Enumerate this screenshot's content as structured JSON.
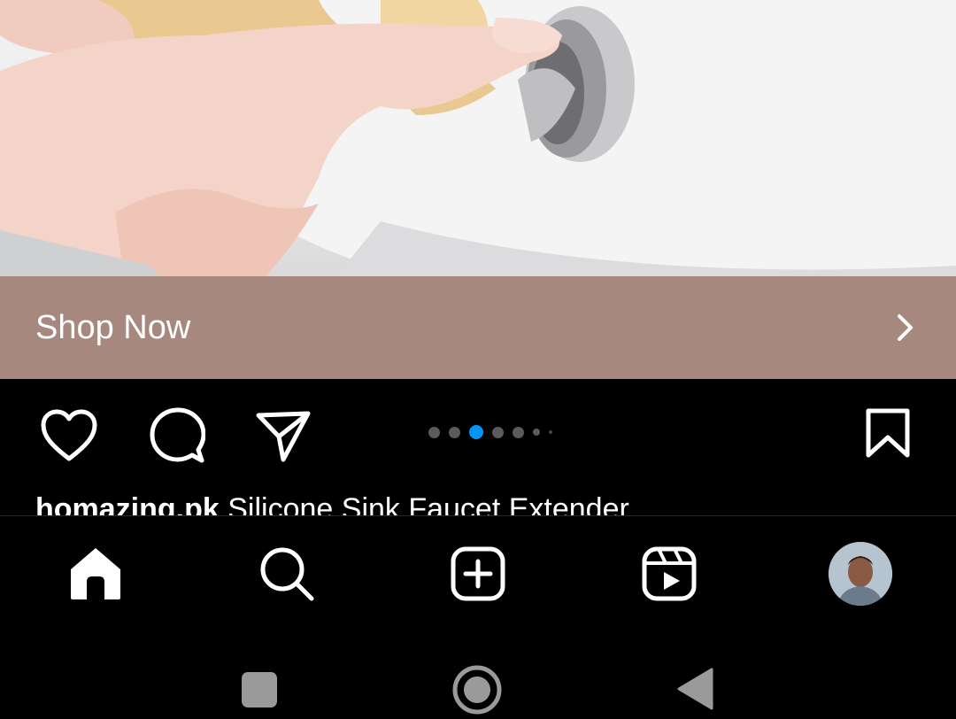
{
  "post_image": {
    "description_icon": "product-photo"
  },
  "cta": {
    "label": "Shop Now",
    "chevron_icon": "chevron-right-icon",
    "background": "#a6887f"
  },
  "actions": {
    "like_icon": "heart-icon",
    "comment_icon": "comment-icon",
    "share_icon": "send-icon",
    "save_icon": "bookmark-icon"
  },
  "carousel": {
    "active_index": 3,
    "total": 7,
    "active_color": "#0095f6"
  },
  "caption": {
    "username": "homazing.pk",
    "text": "Silicone Sink Faucet Extender"
  },
  "tabbar": {
    "items": [
      "home-icon",
      "search-icon",
      "create-post-icon",
      "reels-icon",
      "profile-avatar"
    ]
  },
  "system_nav": {
    "items": [
      "recents-square-icon",
      "home-circle-icon",
      "back-triangle-icon"
    ]
  }
}
